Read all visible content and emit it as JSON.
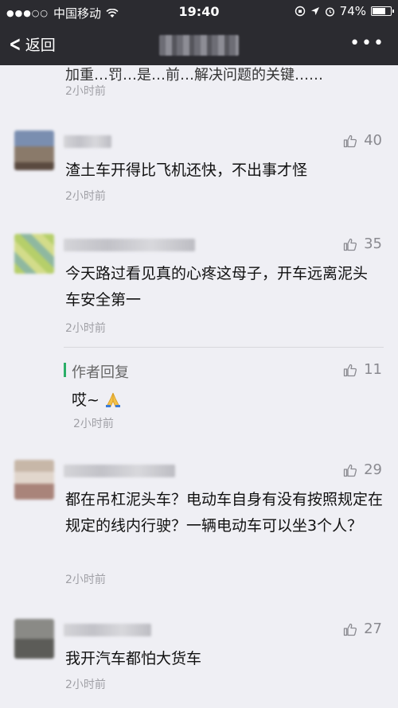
{
  "status_bar": {
    "signal_dots": "●●●○○",
    "carrier": "中国移动",
    "time": "19:40",
    "battery_pct": "74%",
    "battery_level": 0.74
  },
  "nav": {
    "back_label": "返回",
    "more_label": "•••"
  },
  "top_fragment": {
    "text": "加重…罚…是…前…解决问题的关键……",
    "time": "2小时前"
  },
  "comments": [
    {
      "likes": "40",
      "text": "渣土车开得比飞机还快，不出事才怪",
      "time": "2小时前"
    },
    {
      "likes": "35",
      "text": "今天路过看见真的心疼这母子，开车远离泥头车安全第一",
      "time": "2小时前",
      "reply": {
        "label": "作者回复",
        "likes": "11",
        "text": "哎~",
        "time": "2小时前"
      }
    },
    {
      "likes": "29",
      "text": "都在吊杠泥头车？电动车自身有没有按照规定在规定的线内行驶？一辆电动车可以坐3个人？",
      "time": "2小时前"
    },
    {
      "likes": "27",
      "text": "我开汽车都怕大货车",
      "time": "2小时前"
    }
  ],
  "colors": {
    "bar_bg": "#2b2b30",
    "page_bg": "#efeff4",
    "author_accent": "#2aae67",
    "muted": "#a0a0a6"
  },
  "icons": {
    "like": "thumbs-up-outline-icon",
    "back": "chevron-left-icon",
    "emoji": "folded-hands-emoji-icon"
  }
}
